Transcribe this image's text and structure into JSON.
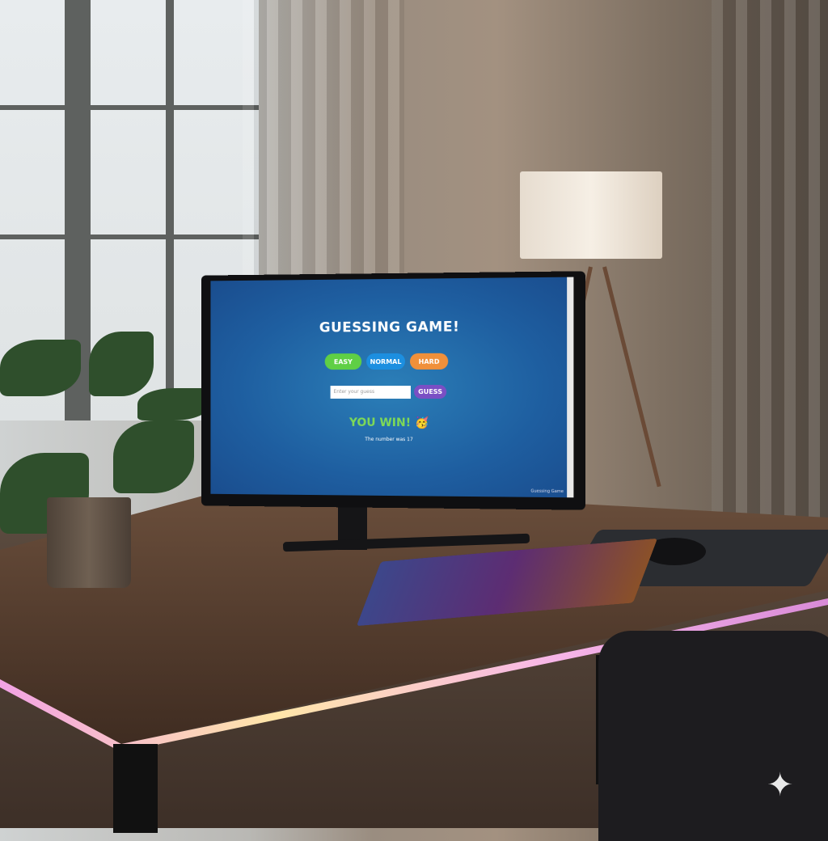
{
  "game": {
    "title": "GUESSING GAME!",
    "difficulty": [
      {
        "label": "EASY",
        "color": "#5fcf45"
      },
      {
        "label": "NORMAL",
        "color": "#1c8fe0"
      },
      {
        "label": "HARD",
        "color": "#f0903a"
      }
    ],
    "input_placeholder": "Enter your guess",
    "guess_label": "GUESS",
    "guess_color": "#7a4fc4",
    "result": "YOU WIN!",
    "result_emoji": "🥳",
    "result_sub": "The number was 17",
    "footer": "Guessing Game"
  }
}
